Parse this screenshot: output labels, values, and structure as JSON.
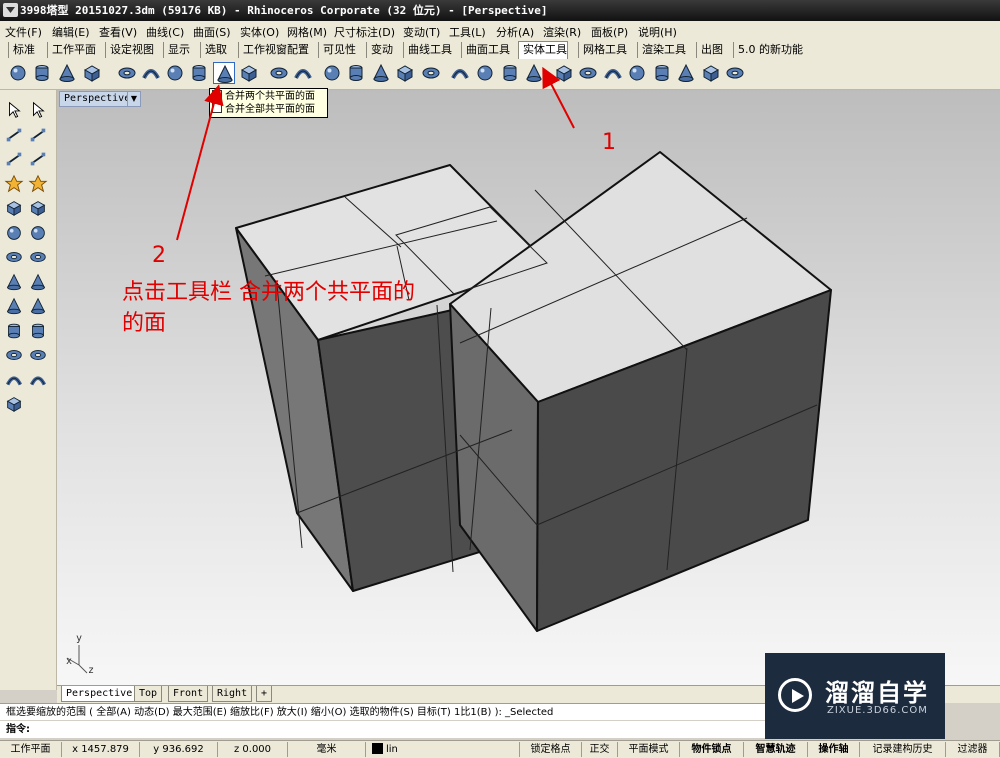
{
  "window": {
    "title": "3998塔型 20151027.3dm (59176 KB) - Rhinoceros Corporate (32 位元) - [Perspective]"
  },
  "menubar": [
    "文件(F)",
    "编辑(E)",
    "查看(V)",
    "曲线(C)",
    "曲面(S)",
    "实体(O)",
    "网格(M)",
    "尺寸标注(D)",
    "变动(T)",
    "工具(L)",
    "分析(A)",
    "渲染(R)",
    "面板(P)",
    "说明(H)"
  ],
  "tabs": [
    "标准",
    "工作平面",
    "设定视图",
    "显示",
    "选取",
    "工作视窗配置",
    "可见性",
    "变动",
    "曲线工具",
    "曲面工具",
    "实体工具",
    "网格工具",
    "渲染工具",
    "出图",
    "5.0 的新功能"
  ],
  "active_tab": "实体工具",
  "tooltip": {
    "line1": "合并两个共平面的面",
    "line2": "合并全部共平面的面"
  },
  "viewport": {
    "title": "Perspective",
    "axis_y": "y",
    "axis_x": "x",
    "axis_z": "z"
  },
  "annotations": {
    "num1": "1",
    "num2": "2",
    "instruction": "点击工具栏 合并两个共平面的",
    "instruction2": "的面"
  },
  "view_tabs": [
    "Perspective",
    "Top",
    "Front",
    "Right"
  ],
  "command": {
    "history": "框选要缩放的范围 ( 全部(A)  动态(D)  最大范围(E)  缩放比(F)  放大(I)  缩小(O)  选取的物件(S)  目标(T)  1比1(B) ): _Selected",
    "prompt": "指令:"
  },
  "status": {
    "cplane": "工作平面",
    "x": "x 1457.879",
    "y": "y 936.692",
    "z": "z 0.000",
    "units": "毫米",
    "layer": "lin",
    "layer_color": "#000000",
    "toggles": [
      "锁定格点",
      "正交",
      "平面模式",
      "物件锁点",
      "智慧轨迹",
      "操作轴",
      "记录建构历史",
      "过滤器"
    ],
    "toggles_on": [
      "物件锁点",
      "智慧轨迹",
      "操作轴"
    ]
  },
  "logo": {
    "brand": "溜溜自学",
    "url": "ZIXUE.3D66.COM"
  },
  "colors": {
    "annotation": "#e00000",
    "face_top": "#e2e2e2",
    "face_side": "#4a4a4a"
  }
}
